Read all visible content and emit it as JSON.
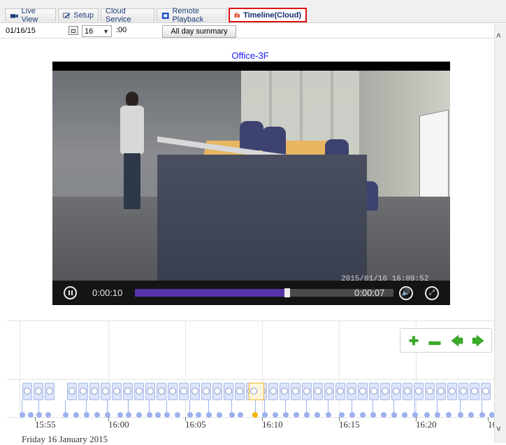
{
  "tabs": [
    {
      "label": "Live View",
      "icon": "camera-icon",
      "active": false
    },
    {
      "label": "Setup",
      "icon": "wrench-icon",
      "active": false
    },
    {
      "label": "Cloud Service",
      "icon": "",
      "active": false
    },
    {
      "label": "Remote Playback",
      "icon": "film-icon",
      "active": false
    },
    {
      "label": "Timeline(Cloud)",
      "icon": "bar-chart-icon",
      "active": true
    }
  ],
  "toolbar": {
    "date_value": "01/16/15",
    "hour_value": "16",
    "minute_label": ":00",
    "summary_label": "All day summary"
  },
  "camera": {
    "title": "Office-3F",
    "overlay_timestamp": "2015/01/16   16:09:52"
  },
  "player": {
    "elapsed": "0:00:10",
    "remaining": "0:00:07",
    "progress": 0.59
  },
  "timeline": {
    "ticks": [
      "15:55",
      "16:00",
      "16:05",
      "16:10",
      "16:15",
      "16:20",
      "16"
    ],
    "date_caption": "Friday 16 January 2015"
  },
  "colors": {
    "accent_blue": "#1a1aff",
    "active_tab_border": "#e01010",
    "progress": "#5633a8",
    "clip_blue": "#9db0ee",
    "selected_clip": "#f4b400",
    "nav_green": "#3aa829"
  }
}
